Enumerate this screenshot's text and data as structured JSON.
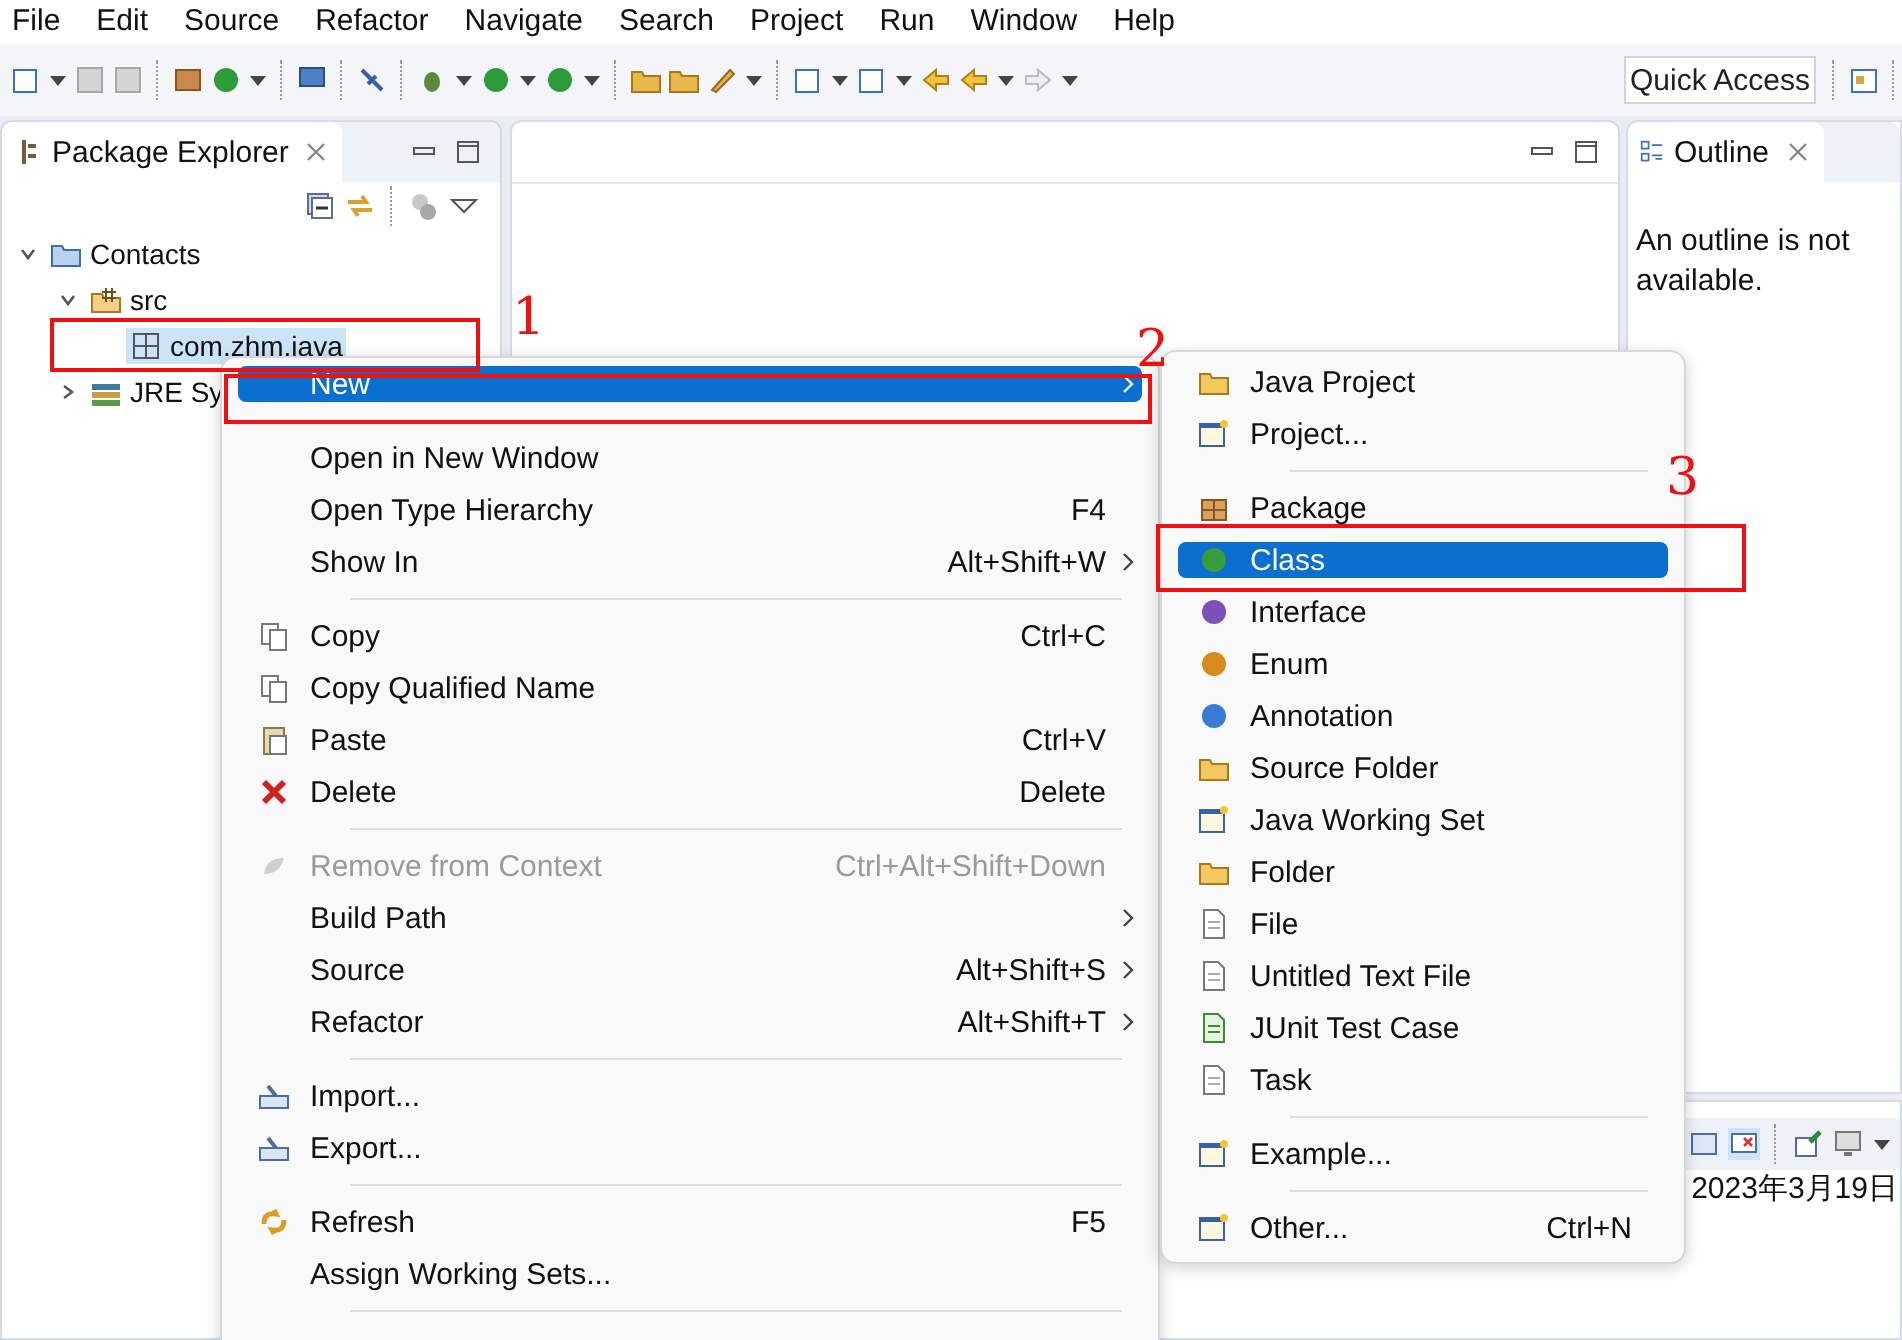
{
  "menu_bar": [
    "File",
    "Edit",
    "Source",
    "Refactor",
    "Navigate",
    "Search",
    "Project",
    "Run",
    "Window",
    "Help"
  ],
  "toolbar": {
    "quick_access": {
      "placeholder": "Quick Access"
    }
  },
  "package_explorer": {
    "title": "Package Explorer",
    "tree": [
      {
        "label": "Contacts",
        "expanded": true,
        "selected": false,
        "children": [
          {
            "label": "src",
            "expanded": true,
            "selected": false,
            "children": [
              {
                "label": "com.zhm.java",
                "selected": true
              }
            ]
          },
          {
            "label": "JRE Sy",
            "expanded": false,
            "selected": false
          }
        ]
      }
    ]
  },
  "outline": {
    "title": "Outline",
    "message": "An outline is not available."
  },
  "bottom_panel": {
    "date": "2023年3月19日"
  },
  "context_menu": [
    {
      "kind": "item",
      "label": "New",
      "submenu": true,
      "selected": true,
      "disabled": false
    },
    {
      "kind": "separator"
    },
    {
      "kind": "item",
      "label": "Open in New Window",
      "selected": false,
      "disabled": false
    },
    {
      "kind": "item",
      "label": "Open Type Hierarchy",
      "shortcut": "F4",
      "selected": false,
      "disabled": false
    },
    {
      "kind": "item",
      "label": "Show In",
      "shortcut": "Alt+Shift+W",
      "submenu": true,
      "selected": false,
      "disabled": false
    },
    {
      "kind": "separator"
    },
    {
      "kind": "item",
      "label": "Copy",
      "shortcut": "Ctrl+C",
      "selected": false,
      "disabled": false
    },
    {
      "kind": "item",
      "label": "Copy Qualified Name",
      "selected": false,
      "disabled": false
    },
    {
      "kind": "item",
      "label": "Paste",
      "shortcut": "Ctrl+V",
      "selected": false,
      "disabled": false
    },
    {
      "kind": "item",
      "label": "Delete",
      "shortcut": "Delete",
      "selected": false,
      "disabled": false
    },
    {
      "kind": "separator"
    },
    {
      "kind": "item",
      "label": "Remove from Context",
      "shortcut": "Ctrl+Alt+Shift+Down",
      "selected": false,
      "disabled": true
    },
    {
      "kind": "item",
      "label": "Build Path",
      "submenu": true,
      "selected": false,
      "disabled": false
    },
    {
      "kind": "item",
      "label": "Source",
      "shortcut": "Alt+Shift+S",
      "submenu": true,
      "selected": false,
      "disabled": false
    },
    {
      "kind": "item",
      "label": "Refactor",
      "shortcut": "Alt+Shift+T",
      "submenu": true,
      "selected": false,
      "disabled": false
    },
    {
      "kind": "separator"
    },
    {
      "kind": "item",
      "label": "Import...",
      "selected": false,
      "disabled": false
    },
    {
      "kind": "item",
      "label": "Export...",
      "selected": false,
      "disabled": false
    },
    {
      "kind": "separator"
    },
    {
      "kind": "item",
      "label": "Refresh",
      "shortcut": "F5",
      "selected": false,
      "disabled": false
    },
    {
      "kind": "item",
      "label": "Assign Working Sets...",
      "selected": false,
      "disabled": false
    },
    {
      "kind": "separator"
    }
  ],
  "new_submenu": [
    {
      "kind": "item",
      "label": "Java Project",
      "selected": false
    },
    {
      "kind": "item",
      "label": "Project...",
      "selected": false
    },
    {
      "kind": "separator"
    },
    {
      "kind": "item",
      "label": "Package",
      "selected": false
    },
    {
      "kind": "item",
      "label": "Class",
      "selected": true
    },
    {
      "kind": "item",
      "label": "Interface",
      "selected": false
    },
    {
      "kind": "item",
      "label": "Enum",
      "selected": false
    },
    {
      "kind": "item",
      "label": "Annotation",
      "selected": false
    },
    {
      "kind": "item",
      "label": "Source Folder",
      "selected": false
    },
    {
      "kind": "item",
      "label": "Java Working Set",
      "selected": false
    },
    {
      "kind": "item",
      "label": "Folder",
      "selected": false
    },
    {
      "kind": "item",
      "label": "File",
      "selected": false
    },
    {
      "kind": "item",
      "label": "Untitled Text File",
      "selected": false
    },
    {
      "kind": "item",
      "label": "JUnit Test Case",
      "selected": false
    },
    {
      "kind": "item",
      "label": "Task",
      "selected": false
    },
    {
      "kind": "separator"
    },
    {
      "kind": "item",
      "label": "Example...",
      "selected": false
    },
    {
      "kind": "separator"
    },
    {
      "kind": "item",
      "label": "Other...",
      "shortcut": "Ctrl+N",
      "selected": false
    }
  ],
  "annotations": [
    {
      "label": "1"
    },
    {
      "label": "2"
    },
    {
      "label": "3"
    }
  ]
}
